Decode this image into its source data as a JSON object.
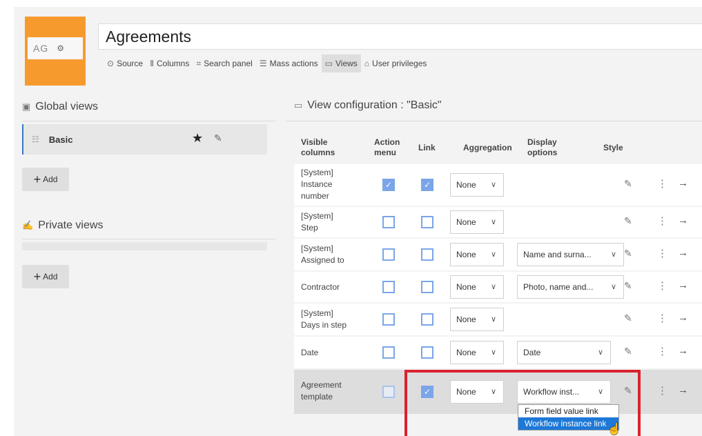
{
  "app": {
    "logo_text": "AG",
    "logo_icon": "user-permission-icon",
    "title": "Agreements"
  },
  "tabs": [
    {
      "label": "Source",
      "icon": "database-icon",
      "glyph": "⊙"
    },
    {
      "label": "Columns",
      "icon": "columns-icon",
      "glyph": "Ⅱ"
    },
    {
      "label": "Search panel",
      "icon": "search-panel-icon",
      "glyph": "⌗"
    },
    {
      "label": "Mass actions",
      "icon": "mass-actions-icon",
      "glyph": "☰"
    },
    {
      "label": "Views",
      "icon": "views-icon",
      "glyph": "▭"
    },
    {
      "label": "User privileges",
      "icon": "user-icon",
      "glyph": "⌂"
    }
  ],
  "global_views": {
    "title": "Global views",
    "items": [
      {
        "name": "Basic"
      }
    ],
    "add_label": "Add"
  },
  "private_views": {
    "title": "Private views",
    "add_label": "Add"
  },
  "config": {
    "title": "View configuration : \"Basic\"",
    "headers": {
      "visible_columns": "Visible columns",
      "action_menu": "Action menu",
      "link": "Link",
      "aggregation": "Aggregation",
      "display_options": "Display options",
      "style": "Style"
    },
    "rows": [
      {
        "label": "[System] Instance number",
        "action_menu": true,
        "link": true,
        "aggregation": "None",
        "display": ""
      },
      {
        "label": "[System] Step",
        "action_menu": false,
        "link": false,
        "aggregation": "None",
        "display": ""
      },
      {
        "label": "[System] Assigned to",
        "action_menu": false,
        "link": false,
        "aggregation": "None",
        "display": "Name and surna..."
      },
      {
        "label": "Contractor",
        "action_menu": false,
        "link": false,
        "aggregation": "None",
        "display": "Photo, name and..."
      },
      {
        "label": "[System] Days in step",
        "action_menu": false,
        "link": false,
        "aggregation": "None",
        "display": ""
      },
      {
        "label": "Date",
        "action_menu": false,
        "link": false,
        "aggregation": "None",
        "display": "Date"
      },
      {
        "label": "Agreement template",
        "action_menu": false,
        "link": true,
        "aggregation": "None",
        "display": "Workflow inst..."
      }
    ],
    "dropdown_options": [
      "Form field value link",
      "Workflow instance link"
    ],
    "highlighted_option": "Workflow instance link"
  },
  "colors": {
    "accent_orange": "#f79a2e",
    "checkbox_blue": "#7aa5e8",
    "highlight_red": "#d9232f",
    "selection_blue": "#1e78d7"
  }
}
